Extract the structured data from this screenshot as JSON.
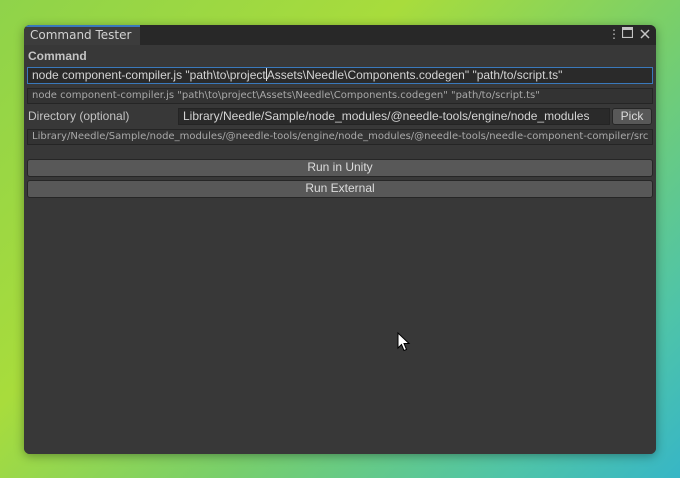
{
  "window": {
    "tab_title": "Command Tester",
    "menu_icon": "kebab-menu-icon",
    "maximize_icon": "maximize-icon",
    "close_icon": "close-icon"
  },
  "command": {
    "label": "Command",
    "value_before_caret": "node component-compiler.js \"path\\to\\project",
    "value_after_caret": "Assets\\Needle\\Components.codegen\" \"path/to/script.ts\"",
    "resolved": "node component-compiler.js \"path\\to\\project\\Assets\\Needle\\Components.codegen\" \"path/to/script.ts\""
  },
  "directory": {
    "label": "Directory (optional)",
    "value": "Library/Needle/Sample/node_modules/@needle-tools/engine/node_modules",
    "pick_label": "Pick",
    "resolved": "Library/Needle/Sample/node_modules/@needle-tools/engine/node_modules/@needle-tools/needle-component-compiler/src"
  },
  "actions": {
    "run_unity": "Run in Unity",
    "run_external": "Run External"
  },
  "colors": {
    "accent": "#3a79bb",
    "panel": "#383838",
    "button": "#585858"
  }
}
